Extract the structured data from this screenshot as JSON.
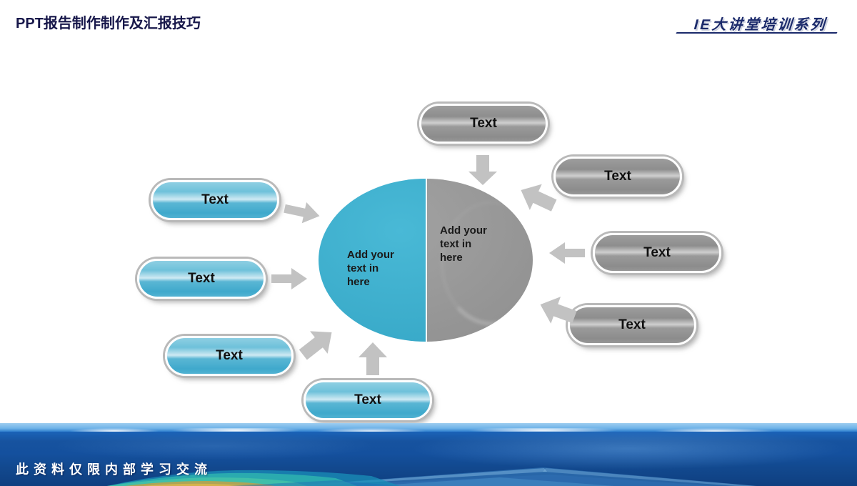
{
  "header": {
    "title": "PPT报告制作制作及汇报技巧",
    "brand": "IE大讲堂培训系列"
  },
  "diagram": {
    "center": {
      "left_half_text": "Add your\ntext in\nhere",
      "right_half_text": "Add your\ntext in\nhere",
      "left_color": "#38a9c8",
      "right_color": "#949494"
    },
    "left_nodes": [
      {
        "label": "Text",
        "color": "#3fa9cc"
      },
      {
        "label": "Text",
        "color": "#3fa9cc"
      },
      {
        "label": "Text",
        "color": "#3fa9cc"
      },
      {
        "label": "Text",
        "color": "#3fa9cc"
      }
    ],
    "right_nodes": [
      {
        "label": "Text",
        "color": "#8e8e8e"
      },
      {
        "label": "Text",
        "color": "#8e8e8e"
      },
      {
        "label": "Text",
        "color": "#8e8e8e"
      },
      {
        "label": "Text",
        "color": "#8e8e8e"
      }
    ],
    "arrow_color": "#c2c2c2"
  },
  "footer": {
    "caption": "此资料仅限内部学习交流"
  }
}
